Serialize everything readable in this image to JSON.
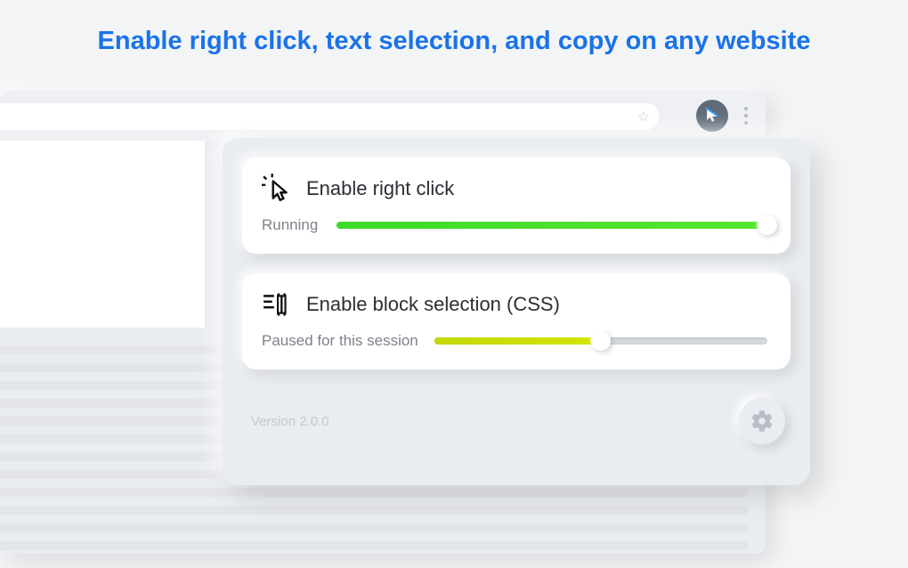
{
  "headline": "Enable right click, text selection, and copy on any website",
  "popup": {
    "card1": {
      "title": "Enable right click",
      "status": "Running",
      "slider_fill_class": "green",
      "knob_class": "k-right"
    },
    "card2": {
      "title": "Enable block selection (CSS)",
      "status": "Paused for this session",
      "slider_fill_class": "yellow",
      "knob_class": "k-mid"
    },
    "version": "Version 2.0.0"
  }
}
